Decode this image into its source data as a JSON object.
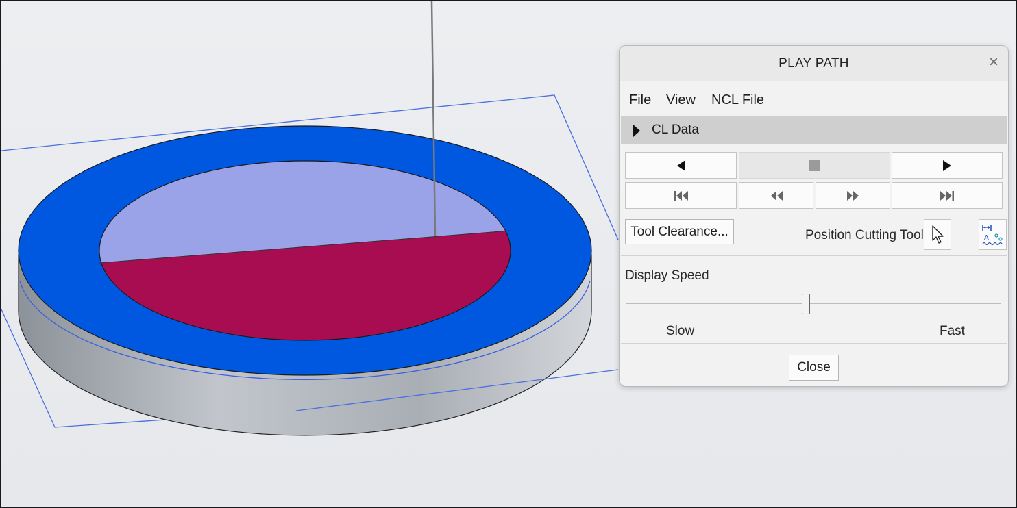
{
  "dialog": {
    "title": "PLAY PATH",
    "close_icon": "close-icon",
    "menu": [
      "File",
      "View",
      "NCL File"
    ],
    "cl_data_label": "CL Data",
    "playback_controls": {
      "row1": [
        "step-back-icon",
        "stop-icon",
        "play-icon"
      ],
      "row2": [
        "go-to-start-icon",
        "rewind-icon",
        "fast-forward-icon",
        "go-to-end-icon"
      ]
    },
    "tool_clearance_label": "Tool Clearance...",
    "position_cutting_tool_label": "Position Cutting Tool",
    "display_speed_label": "Display Speed",
    "slow_label": "Slow",
    "fast_label": "Fast",
    "speed_value": 0.48,
    "close_label": "Close"
  },
  "colors": {
    "part_top": "#0057e0",
    "part_side": "#a4a9b0",
    "inner_face": "#9ba3e8",
    "cut_region": "#a80d52",
    "outline": "#4169e1"
  }
}
